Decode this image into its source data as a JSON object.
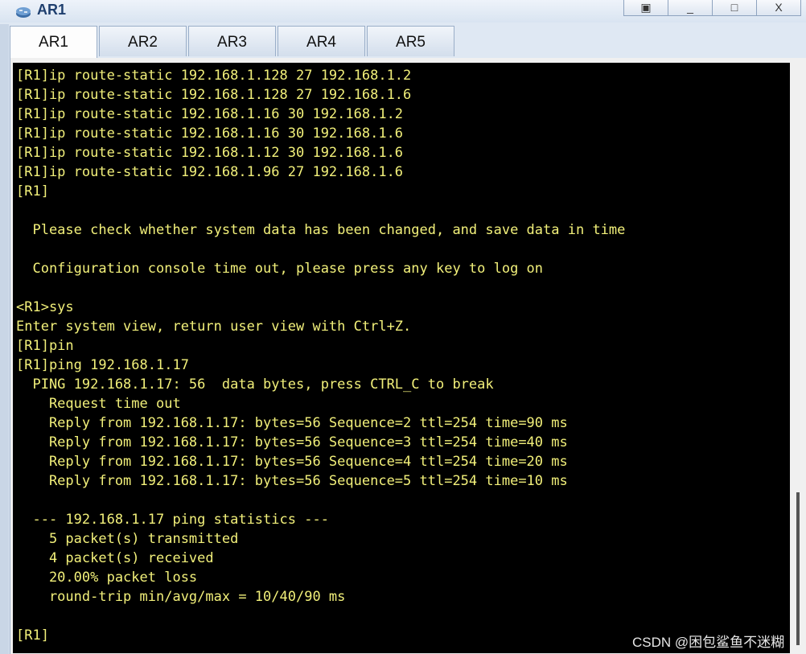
{
  "window": {
    "title": "AR1"
  },
  "tabs": [
    "AR1",
    "AR2",
    "AR3",
    "AR4",
    "AR5"
  ],
  "active_tab": "AR1",
  "terminal_lines": [
    "[R1]ip route-static 192.168.1.128 27 192.168.1.2",
    "[R1]ip route-static 192.168.1.128 27 192.168.1.6",
    "[R1]ip route-static 192.168.1.16 30 192.168.1.2",
    "[R1]ip route-static 192.168.1.16 30 192.168.1.6",
    "[R1]ip route-static 192.168.1.12 30 192.168.1.6",
    "[R1]ip route-static 192.168.1.96 27 192.168.1.6",
    "[R1]",
    "",
    "  Please check whether system data has been changed, and save data in time",
    "",
    "  Configuration console time out, please press any key to log on",
    "",
    "<R1>sys",
    "Enter system view, return user view with Ctrl+Z.",
    "[R1]pin",
    "[R1]ping 192.168.1.17",
    "  PING 192.168.1.17: 56  data bytes, press CTRL_C to break",
    "    Request time out",
    "    Reply from 192.168.1.17: bytes=56 Sequence=2 ttl=254 time=90 ms",
    "    Reply from 192.168.1.17: bytes=56 Sequence=3 ttl=254 time=40 ms",
    "    Reply from 192.168.1.17: bytes=56 Sequence=4 ttl=254 time=20 ms",
    "    Reply from 192.168.1.17: bytes=56 Sequence=5 ttl=254 time=10 ms",
    "",
    "  --- 192.168.1.17 ping statistics ---",
    "    5 packet(s) transmitted",
    "    4 packet(s) received",
    "    20.00% packet loss",
    "    round-trip min/avg/max = 10/40/90 ms",
    "",
    "[R1]"
  ],
  "watermark": "CSDN @困包鲨鱼不迷糊",
  "colors": {
    "terminal_text": "#f2f07a",
    "terminal_bg": "#000000"
  },
  "icons": {
    "app": "router-app-icon"
  }
}
